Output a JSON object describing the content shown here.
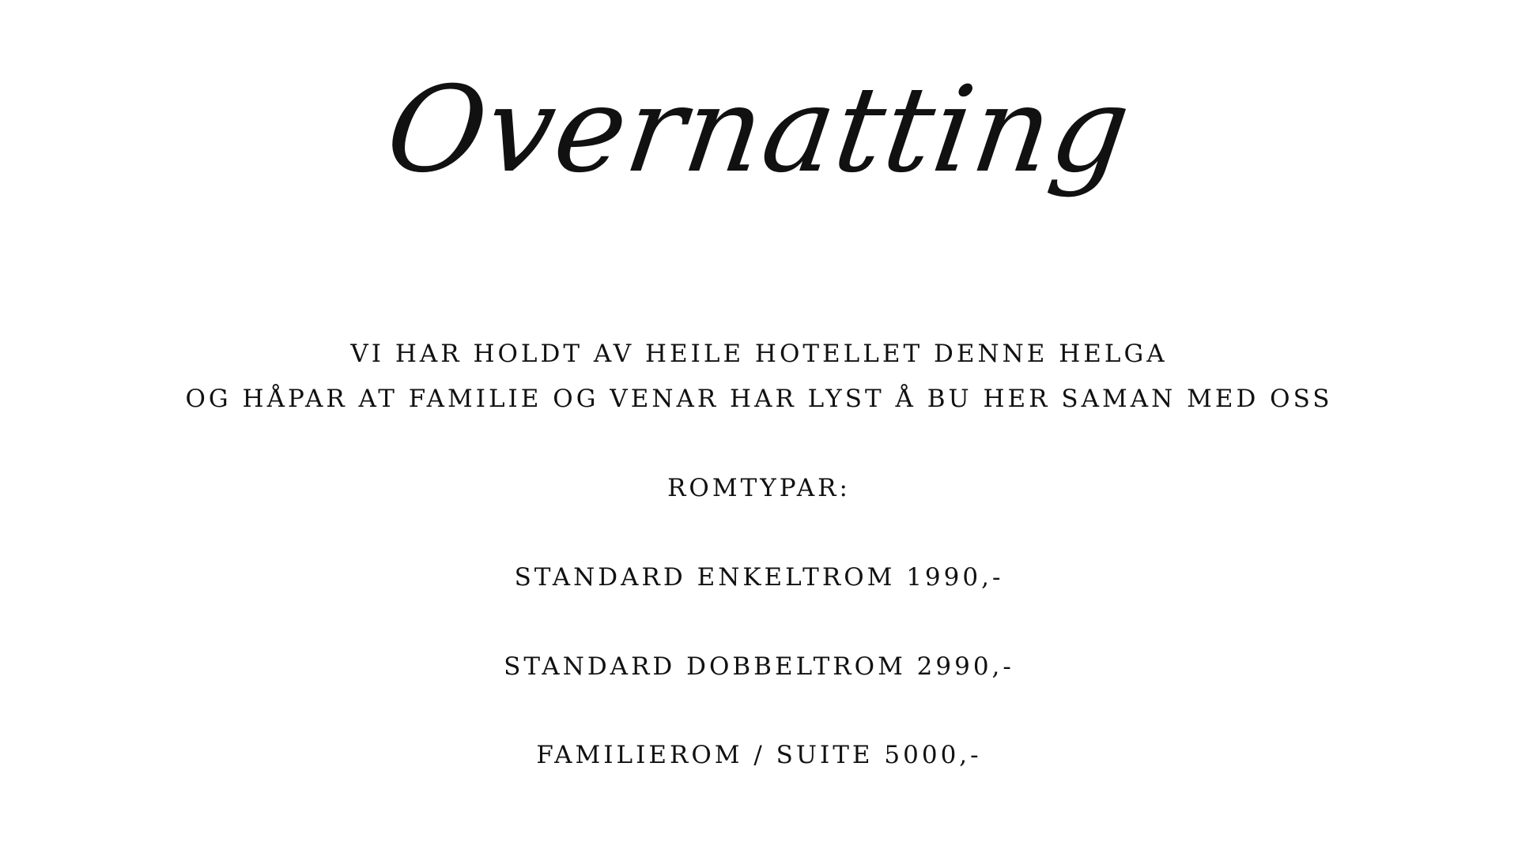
{
  "title": "Overnatting",
  "intro": {
    "line1": "VI HAR HOLDT AV HEILE HOTELLET DENNE HELGA",
    "line2": "OG HÅPAR AT FAMILIE OG VENAR HAR LYST Å BU HER SAMAN MED OSS"
  },
  "rooms": {
    "heading": "ROMTYPAR:",
    "items": [
      "STANDARD ENKELTROM 1990,-",
      "STANDARD DOBBELTROM 2990,-",
      "FAMILIEROM / SUITE 5000,-"
    ]
  }
}
